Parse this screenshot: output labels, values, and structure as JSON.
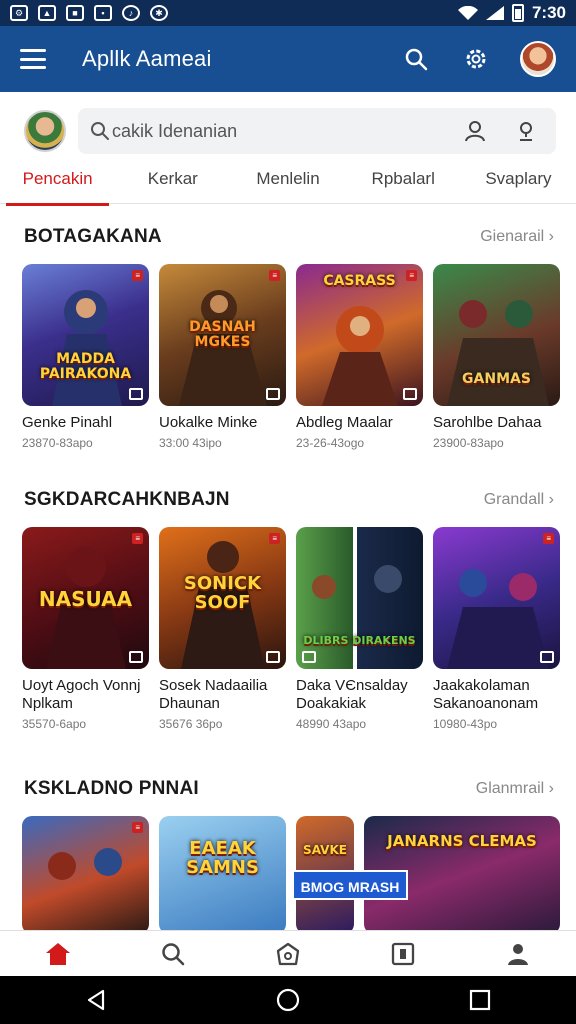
{
  "status_bar": {
    "time": "7:30",
    "icons": [
      "app-icon",
      "mail-icon",
      "file-icon",
      "bag-icon",
      "music-icon",
      "puzzle-icon"
    ]
  },
  "app_bar": {
    "title": "Apllk Aamеai"
  },
  "search": {
    "placeholder": "cаkik Idenаnian"
  },
  "tabs": [
    {
      "label": "Pencakin",
      "active": true
    },
    {
      "label": "Kerkar"
    },
    {
      "label": "Menlelin"
    },
    {
      "label": "Rpbalarl"
    },
    {
      "label": "Svaplary"
    }
  ],
  "sections": [
    {
      "title": "BOTAGAKANA",
      "more": "Gienarail",
      "items": [
        {
          "title": "Genke Pinahl",
          "meta": "23870-83apo",
          "art": "MADDA PAIRAKONA"
        },
        {
          "title": "Uokalke Minke",
          "meta": "33:00 43ipo",
          "art": "DASNAH MGKES"
        },
        {
          "title": "Abdleg Maalar",
          "meta": "23-26-43ogo",
          "art": "CASRASS"
        },
        {
          "title": "Sarohlbe Dahaa",
          "meta": "23900-83apo",
          "art": "GANMAS"
        }
      ]
    },
    {
      "title": "SGKDARCAHKNBAJN",
      "more": "Grandall",
      "items": [
        {
          "title": "Uoyt Agoch Vonnj Nplkam",
          "meta": "35570-6apo",
          "art": "NASUAA"
        },
        {
          "title": "Sosek Nadaailia Dhaunan",
          "meta": "35676 36po",
          "art": "SONICK SOOF"
        },
        {
          "title": "Daka VЄnsalday Doakakiak",
          "meta": "48990 43apo",
          "art": "DLIBRS DIRAKENS"
        },
        {
          "title": "Jaakakolaman Sakanoanonam",
          "meta": "10980-43po",
          "art": ""
        }
      ]
    },
    {
      "title": "KSKLADNO PNNAI",
      "more": "Glanmrail",
      "items": [
        {
          "title": "",
          "meta": "",
          "art": ""
        },
        {
          "title": "",
          "meta": "",
          "art": "EAEAK SAMNS"
        },
        {
          "title": "",
          "meta": "",
          "art": "SAVKE"
        },
        {
          "title": "",
          "meta": "",
          "art": "JANARNS CLEMAS"
        }
      ],
      "banner": "BMOG MRASH"
    }
  ],
  "bottom_nav": [
    "home-icon",
    "search-icon",
    "store-icon",
    "library-icon",
    "profile-icon"
  ],
  "colors": {
    "status_bar": "#0f2c57",
    "app_bar": "#184f93",
    "accent_red": "#d21a1a"
  }
}
